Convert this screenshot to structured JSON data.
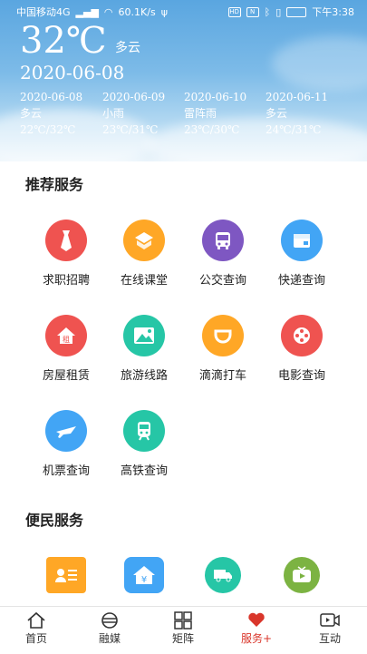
{
  "status": {
    "carrier": "中国移动4G",
    "speed": "60.1K/s",
    "time": "下午3:38"
  },
  "weather": {
    "temp": "32℃",
    "condition": "多云",
    "date": "2020-06-08",
    "forecast": [
      {
        "date": "2020-06-08",
        "cond": "多云",
        "range": "22℃/32℃"
      },
      {
        "date": "2020-06-09",
        "cond": "小雨",
        "range": "23℃/31℃"
      },
      {
        "date": "2020-06-10",
        "cond": "雷阵雨",
        "range": "23℃/30℃"
      },
      {
        "date": "2020-06-11",
        "cond": "多云",
        "range": "24℃/31℃"
      }
    ]
  },
  "recommended": {
    "title": "推荐服务",
    "items": [
      {
        "label": "求职招聘",
        "color": "#ef5350",
        "icon": "tie-icon"
      },
      {
        "label": "在线课堂",
        "color": "#ffa726",
        "icon": "book-icon"
      },
      {
        "label": "公交查询",
        "color": "#7e57c2",
        "icon": "bus-icon"
      },
      {
        "label": "快递查询",
        "color": "#42a5f5",
        "icon": "package-icon"
      },
      {
        "label": "房屋租赁",
        "color": "#ef5350",
        "icon": "house-icon"
      },
      {
        "label": "旅游线路",
        "color": "#26c6a6",
        "icon": "mountain-icon"
      },
      {
        "label": "滴滴打车",
        "color": "#ffa726",
        "icon": "didi-icon"
      },
      {
        "label": "电影查询",
        "color": "#ef5350",
        "icon": "film-icon"
      },
      {
        "label": "机票查询",
        "color": "#42a5f5",
        "icon": "plane-icon"
      },
      {
        "label": "高铁查询",
        "color": "#26c6a6",
        "icon": "train-icon"
      }
    ]
  },
  "convenience": {
    "title": "便民服务",
    "items": [
      {
        "color": "#ffa726",
        "icon": "id-card-icon"
      },
      {
        "color": "#42a5f5",
        "icon": "housing-fund-icon"
      },
      {
        "color": "#26c6a6",
        "icon": "truck-icon"
      },
      {
        "color": "#7cb342",
        "icon": "tv-icon"
      }
    ]
  },
  "tabs": [
    {
      "label": "首页",
      "icon": "home-icon"
    },
    {
      "label": "融媒",
      "icon": "media-icon"
    },
    {
      "label": "矩阵",
      "icon": "grid-icon"
    },
    {
      "label": "服务+",
      "icon": "heart-hand-icon",
      "active": true
    },
    {
      "label": "互动",
      "icon": "video-icon"
    }
  ]
}
